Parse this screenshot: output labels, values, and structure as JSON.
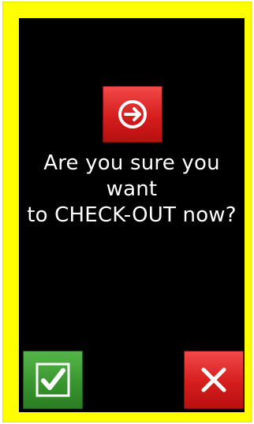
{
  "dialog": {
    "icon": "checkout-arrow-icon",
    "question_line1": "Are you sure you want",
    "question_line2": "to CHECK-OUT now?"
  },
  "actions": {
    "confirm_icon": "check-icon",
    "cancel_icon": "close-icon"
  },
  "colors": {
    "frame": "#ffff00",
    "screen": "#000000",
    "confirm": "#3a9a30",
    "cancel": "#d51d1d",
    "text": "#ffffff"
  }
}
